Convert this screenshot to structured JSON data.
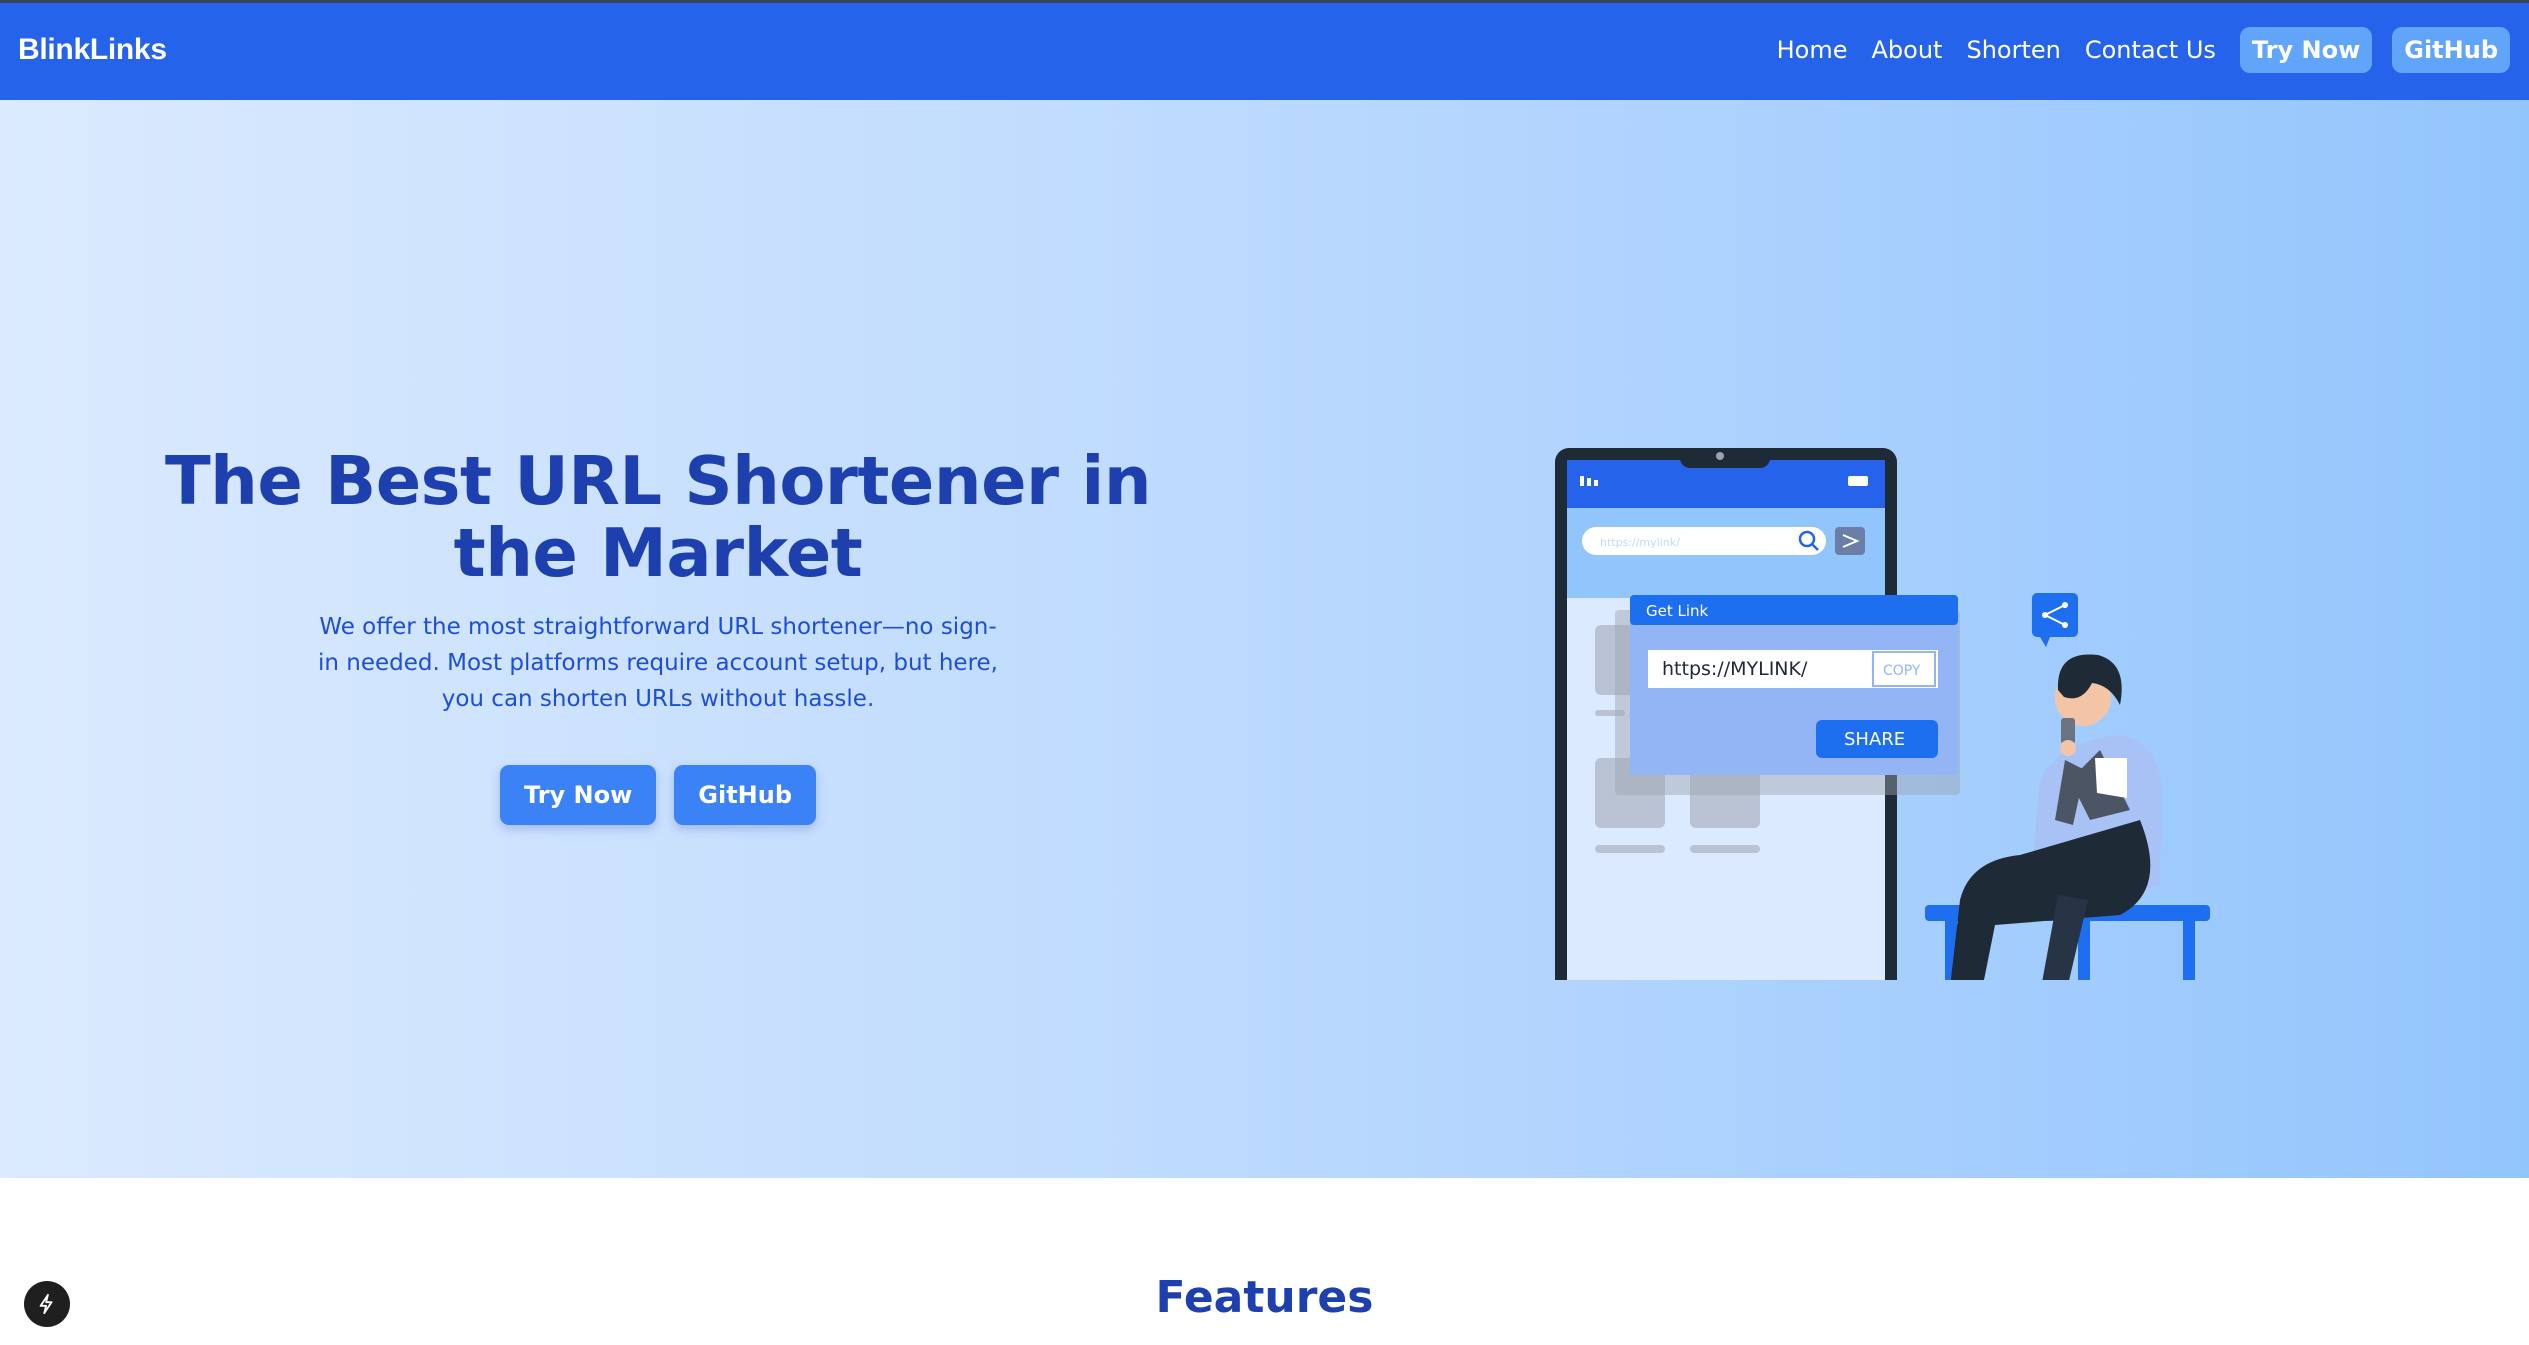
{
  "nav": {
    "brand": "BlinkLinks",
    "links": [
      "Home",
      "About",
      "Shorten",
      "Contact Us"
    ],
    "try_now": "Try Now",
    "github": "GitHub"
  },
  "hero": {
    "title": "The Best URL Shortener in the Market",
    "subtitle": "We offer the most straightforward URL shortener—no sign-in needed. Most platforms require account setup, but here, you can shorten URLs without hassle.",
    "try_now": "Try Now",
    "github": "GitHub"
  },
  "illustration": {
    "url_placeholder": "https://mylink/",
    "panel_title": "Get Link",
    "link_value": "https://MYLINK/",
    "copy_label": "COPY",
    "share_label": "SHARE"
  },
  "features": {
    "title": "Features"
  },
  "colors": {
    "nav_bg": "#2563eb",
    "accent": "#3b82f6",
    "heading": "#1e40af",
    "hero_gradient_start": "#dbeafe",
    "hero_gradient_end": "#93c5fd"
  },
  "icons": [
    "search-icon",
    "share-icon",
    "lightning-icon"
  ]
}
